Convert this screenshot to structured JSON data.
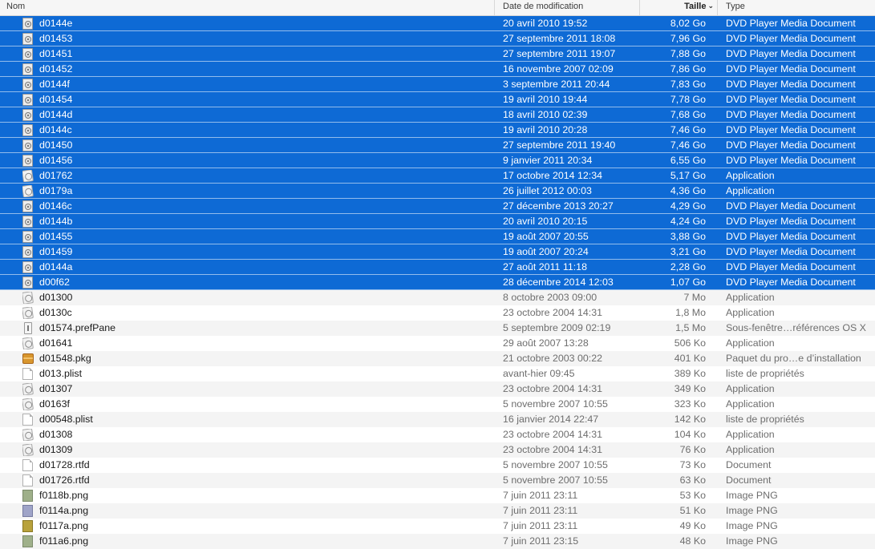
{
  "columns": {
    "name": "Nom",
    "date": "Date de modification",
    "size": "Taille",
    "type": "Type"
  },
  "sort_indicator": "chevron-down-icon",
  "accent_color": "#0e6ad5",
  "rows": [
    {
      "name": "d0144e",
      "date": "20 avril 2010 19:52",
      "size": "8,02 Go",
      "type": "DVD Player Media Document",
      "icon": "dvd-document-icon",
      "selected": true
    },
    {
      "name": "d01453",
      "date": "27 septembre 2011 18:08",
      "size": "7,96 Go",
      "type": "DVD Player Media Document",
      "icon": "dvd-document-icon",
      "selected": true
    },
    {
      "name": "d01451",
      "date": "27 septembre 2011 19:07",
      "size": "7,88 Go",
      "type": "DVD Player Media Document",
      "icon": "dvd-document-icon",
      "selected": true
    },
    {
      "name": "d01452",
      "date": "16 novembre 2007 02:09",
      "size": "7,86 Go",
      "type": "DVD Player Media Document",
      "icon": "dvd-document-icon",
      "selected": true
    },
    {
      "name": "d0144f",
      "date": "3 septembre 2011 20:44",
      "size": "7,83 Go",
      "type": "DVD Player Media Document",
      "icon": "dvd-document-icon",
      "selected": true
    },
    {
      "name": "d01454",
      "date": "19 avril 2010 19:44",
      "size": "7,78 Go",
      "type": "DVD Player Media Document",
      "icon": "dvd-document-icon",
      "selected": true
    },
    {
      "name": "d0144d",
      "date": "18 avril 2010 02:39",
      "size": "7,68 Go",
      "type": "DVD Player Media Document",
      "icon": "dvd-document-icon",
      "selected": true
    },
    {
      "name": "d0144c",
      "date": "19 avril 2010 20:28",
      "size": "7,46 Go",
      "type": "DVD Player Media Document",
      "icon": "dvd-document-icon",
      "selected": true
    },
    {
      "name": "d01450",
      "date": "27 septembre 2011 19:40",
      "size": "7,46 Go",
      "type": "DVD Player Media Document",
      "icon": "dvd-document-icon",
      "selected": true
    },
    {
      "name": "d01456",
      "date": "9 janvier 2011 20:34",
      "size": "6,55 Go",
      "type": "DVD Player Media Document",
      "icon": "dvd-document-icon",
      "selected": true
    },
    {
      "name": "d01762",
      "date": "17 octobre 2014 12:34",
      "size": "5,17 Go",
      "type": "Application",
      "icon": "application-icon",
      "selected": true
    },
    {
      "name": "d0179a",
      "date": "26 juillet 2012 00:03",
      "size": "4,36 Go",
      "type": "Application",
      "icon": "application-icon",
      "selected": true
    },
    {
      "name": "d0146c",
      "date": "27 décembre 2013 20:27",
      "size": "4,29 Go",
      "type": "DVD Player Media Document",
      "icon": "dvd-document-icon",
      "selected": true
    },
    {
      "name": "d0144b",
      "date": "20 avril 2010 20:15",
      "size": "4,24 Go",
      "type": "DVD Player Media Document",
      "icon": "dvd-document-icon",
      "selected": true
    },
    {
      "name": "d01455",
      "date": "19 août 2007 20:55",
      "size": "3,88 Go",
      "type": "DVD Player Media Document",
      "icon": "dvd-document-icon",
      "selected": true
    },
    {
      "name": "d01459",
      "date": "19 août 2007 20:24",
      "size": "3,21 Go",
      "type": "DVD Player Media Document",
      "icon": "dvd-document-icon",
      "selected": true
    },
    {
      "name": "d0144a",
      "date": "27 août 2011 11:18",
      "size": "2,28 Go",
      "type": "DVD Player Media Document",
      "icon": "dvd-document-icon",
      "selected": true
    },
    {
      "name": "d00f62",
      "date": "28 décembre 2014 12:03",
      "size": "1,07 Go",
      "type": "DVD Player Media Document",
      "icon": "dvd-document-icon",
      "selected": true
    },
    {
      "name": "d01300",
      "date": "8 octobre 2003 09:00",
      "size": "7 Mo",
      "type": "Application",
      "icon": "application-icon",
      "selected": false
    },
    {
      "name": "d0130c",
      "date": "23 octobre 2004 14:31",
      "size": "1,8 Mo",
      "type": "Application",
      "icon": "application-icon",
      "selected": false
    },
    {
      "name": "d01574.prefPane",
      "date": "5 septembre 2009 02:19",
      "size": "1,5 Mo",
      "type": "Sous-fenêtre…références OS X",
      "icon": "preference-pane-icon",
      "selected": false
    },
    {
      "name": "d01641",
      "date": "29 août 2007 13:28",
      "size": "506 Ko",
      "type": "Application",
      "icon": "application-icon",
      "selected": false
    },
    {
      "name": "d01548.pkg",
      "date": "21 octobre 2003 00:22",
      "size": "401 Ko",
      "type": "Paquet du pro…e d’installation",
      "icon": "package-icon",
      "selected": false
    },
    {
      "name": "d013.plist",
      "date": "avant-hier 09:45",
      "size": "389 Ko",
      "type": "liste de propriétés",
      "icon": "document-icon",
      "selected": false
    },
    {
      "name": "d01307",
      "date": "23 octobre 2004 14:31",
      "size": "349 Ko",
      "type": "Application",
      "icon": "application-icon",
      "selected": false
    },
    {
      "name": "d0163f",
      "date": "5 novembre 2007 10:55",
      "size": "323 Ko",
      "type": "Application",
      "icon": "application-icon",
      "selected": false
    },
    {
      "name": "d00548.plist",
      "date": "16 janvier 2014 22:47",
      "size": "142 Ko",
      "type": "liste de propriétés",
      "icon": "document-icon",
      "selected": false
    },
    {
      "name": "d01308",
      "date": "23 octobre 2004 14:31",
      "size": "104 Ko",
      "type": "Application",
      "icon": "application-icon",
      "selected": false
    },
    {
      "name": "d01309",
      "date": "23 octobre 2004 14:31",
      "size": "76 Ko",
      "type": "Application",
      "icon": "application-icon",
      "selected": false
    },
    {
      "name": "d01728.rtfd",
      "date": "5 novembre 2007 10:55",
      "size": "73 Ko",
      "type": "Document",
      "icon": "document-icon",
      "selected": false
    },
    {
      "name": "d01726.rtfd",
      "date": "5 novembre 2007 10:55",
      "size": "63 Ko",
      "type": "Document",
      "icon": "document-icon",
      "selected": false
    },
    {
      "name": "f0118b.png",
      "date": "7 juin 2011 23:11",
      "size": "53 Ko",
      "type": "Image PNG",
      "icon": "png-image-icon",
      "selected": false
    },
    {
      "name": "f0114a.png",
      "date": "7 juin 2011 23:11",
      "size": "51 Ko",
      "type": "Image PNG",
      "icon": "png-image-icon",
      "selected": false
    },
    {
      "name": "f0117a.png",
      "date": "7 juin 2011 23:11",
      "size": "49 Ko",
      "type": "Image PNG",
      "icon": "png-image-icon",
      "selected": false
    },
    {
      "name": "f011a6.png",
      "date": "7 juin 2011 23:15",
      "size": "48 Ko",
      "type": "Image PNG",
      "icon": "png-image-icon",
      "selected": false
    }
  ]
}
